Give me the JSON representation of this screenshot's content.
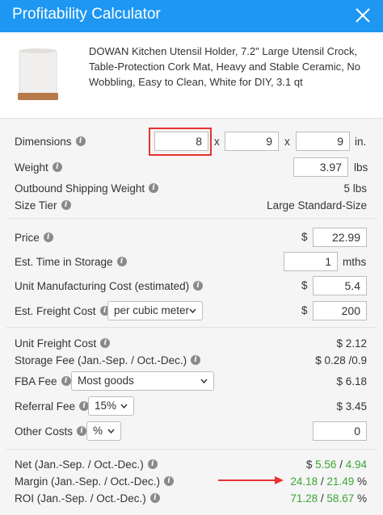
{
  "header": {
    "title": "Profitability Calculator"
  },
  "product": {
    "title": "DOWAN Kitchen Utensil Holder, 7.2\" Large Utensil Crock, Table-Protection Cork Mat, Heavy and Stable Ceramic, No Wobbling, Easy to Clean, White for DIY, 3.1 qt"
  },
  "dimensions": {
    "label": "Dimensions",
    "length": "8",
    "width": "9",
    "height": "9",
    "x": "x",
    "unit": "in."
  },
  "weight": {
    "label": "Weight",
    "value": "3.97",
    "unit": "lbs"
  },
  "outbound": {
    "label": "Outbound Shipping Weight",
    "value": "5 lbs"
  },
  "size_tier": {
    "label": "Size Tier",
    "value": "Large Standard-Size"
  },
  "price": {
    "label": "Price",
    "currency": "$",
    "value": "22.99"
  },
  "storage_time": {
    "label": "Est. Time in Storage",
    "value": "1",
    "unit": "mths"
  },
  "mfg_cost": {
    "label": "Unit Manufacturing Cost (estimated)",
    "currency": "$",
    "value": "5.4"
  },
  "freight_cost": {
    "label": "Est. Freight Cost",
    "mode": "per cubic meter",
    "currency": "$",
    "value": "200"
  },
  "unit_freight": {
    "label": "Unit Freight Cost",
    "value": "$ 2.12"
  },
  "storage_fee": {
    "label": "Storage Fee (Jan.-Sep. / Oct.-Dec.)",
    "value": "$ 0.28 /0.9"
  },
  "fba_fee": {
    "label": "FBA Fee",
    "mode": "Most goods",
    "value": "$ 6.18"
  },
  "referral_fee": {
    "label": "Referral Fee",
    "percent": "15%",
    "value": "$ 3.45"
  },
  "other_costs": {
    "label": "Other Costs",
    "unit": "%",
    "value": "0"
  },
  "net": {
    "label": "Net (Jan.-Sep. / Oct.-Dec.)",
    "prefix": "$",
    "a": "5.56",
    "sep": "/",
    "b": "4.94"
  },
  "margin": {
    "label": "Margin (Jan.-Sep. / Oct.-Dec.)",
    "a": "24.18",
    "sep": "/",
    "b": "21.49",
    "suffix": "%"
  },
  "roi": {
    "label": "ROI (Jan.-Sep. / Oct.-Dec.)",
    "a": "71.28",
    "sep": "/",
    "b": "58.67",
    "suffix": "%"
  },
  "colors": {
    "header": "#1e97f3",
    "green": "#3aa635",
    "highlight": "#e8322f"
  }
}
